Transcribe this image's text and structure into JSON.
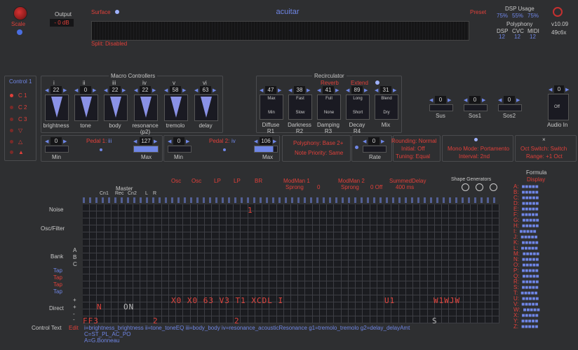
{
  "scale": {
    "label": "Scale"
  },
  "output": {
    "label": "Output",
    "value": "- 0 dB"
  },
  "surface": {
    "label": "Surface",
    "split": "Split: Disabled"
  },
  "title": "acuitar",
  "preset": {
    "label": "Preset"
  },
  "dsp": {
    "label": "DSP Usage",
    "values": [
      "75%",
      "55%",
      "75%"
    ],
    "polyphony_label": "Polyphony",
    "cols": [
      "DSP",
      "CVC",
      "MIDI"
    ],
    "col_values": [
      "12",
      "12",
      "12"
    ]
  },
  "version": {
    "line1": "v10.09",
    "line2": "49c6x"
  },
  "control": {
    "label": "Control 1",
    "items": [
      "C 1",
      "C 2",
      "C 3",
      "▽",
      "△",
      "▲"
    ]
  },
  "macro": {
    "title": "Macro Controllers",
    "items": [
      {
        "roman": "i",
        "value": "22",
        "name": "brightness"
      },
      {
        "roman": "ii",
        "value": "0",
        "name": "tone"
      },
      {
        "roman": "iii",
        "value": "22",
        "name": "body"
      },
      {
        "roman": "iv",
        "value": "22",
        "name": "resonance\n(p2)"
      },
      {
        "roman": "v",
        "value": "58",
        "name": "tremolo"
      },
      {
        "roman": "vi",
        "value": "63",
        "name": "delay"
      }
    ]
  },
  "recirculator": {
    "title": "Recirculator",
    "reverb": "Reverb",
    "extend": "Extend",
    "items": [
      {
        "value": "47",
        "top": "Max",
        "bottom": "Min",
        "name": "Diffuse",
        "sub": "R1"
      },
      {
        "value": "38",
        "top": "Fast",
        "bottom": "Slow",
        "name": "Darkness",
        "sub": "R2"
      },
      {
        "value": "41",
        "top": "Full",
        "bottom": "None",
        "name": "Damping",
        "sub": "R3"
      },
      {
        "value": "89",
        "top": "Long",
        "bottom": "Short",
        "name": "Decay",
        "sub": "R4"
      },
      {
        "value": "31",
        "top": "Blend",
        "bottom": "Dry",
        "name": "Mix",
        "sub": ""
      }
    ]
  },
  "sus": [
    {
      "value": "0",
      "name": "Sus"
    },
    {
      "value": "0",
      "name": "Sos1"
    },
    {
      "value": "0",
      "name": "Sos2"
    }
  ],
  "audio_in": {
    "value": "0",
    "toggle": "Off",
    "name": "Audio In"
  },
  "pedal1": {
    "label": "Pedal 1:",
    "assign": "iii",
    "min_value": "0",
    "max_value": "127",
    "min": "Min",
    "max": "Max"
  },
  "pedal2": {
    "label": "Pedal 2:",
    "assign": "iv",
    "min_value": "0",
    "max_value": "106",
    "min": "Min",
    "max": "Max"
  },
  "polyphony": {
    "line1": "Polyphony: Base 2+",
    "line2": "Note Priority: Same"
  },
  "rate": {
    "value": "0",
    "name": "Rate"
  },
  "rounding": {
    "line1": "Rounding: Normal",
    "line2": "Initial: Off",
    "line3": "Tuning: Equal"
  },
  "mono": {
    "line1": "Mono Mode: Portamento",
    "line2": "Interval: 2nd"
  },
  "oct": {
    "line1": "Oct Switch: Switch",
    "line2": "Range: +1 Oct"
  },
  "master": {
    "label": "Master",
    "subs": [
      "Cn1",
      "Rec",
      "Cn2",
      "L",
      "R"
    ]
  },
  "header_tags": [
    "Osc",
    "Osc",
    "LP",
    "LP",
    "BR",
    "ModMan 1",
    "ModMan 2",
    "SummedDelay"
  ],
  "modman1": {
    "sub": "Sprong",
    "val": "0"
  },
  "modman2": {
    "sub": "Sprong",
    "val": "0 Off"
  },
  "summed": {
    "val": "400 ms"
  },
  "shape_gen": "Shape Generators",
  "formula": {
    "title": "Formula",
    "display": "Display",
    "rows": [
      "A:",
      "B:",
      "C:",
      "D:",
      "E:",
      "F:",
      "G:",
      "H:",
      "I:",
      "J:",
      "K:",
      "L:",
      "M:",
      "N:",
      "O:",
      "P:",
      "Q:",
      "R:",
      "S:",
      "T:",
      "U:",
      "V:",
      "W:",
      "X:",
      "Y:",
      "Z:"
    ]
  },
  "row_labels": {
    "noise": "Noise",
    "osc_filter": "Osc/Filter",
    "bank": "Bank",
    "tap": [
      "Tap",
      "Tap",
      "Tap",
      "Tap"
    ],
    "direct": "Direct",
    "bank_letters": [
      "A",
      "B",
      "C"
    ],
    "direct_signs": [
      "+",
      "+",
      "-",
      "-"
    ]
  },
  "control_text": {
    "label": "Control Text",
    "edit": "Edit",
    "lines": [
      "i=brightness_brightness ii=tone_toneEQ iii=body_body iv=resonance_acousticResonance g1=tremolo_tremolo g2=delay_delayAmt",
      "C=ST_PL_AC_PO",
      "A=G.Bonneau"
    ]
  },
  "grid_text": {
    "on": "ON",
    "seq": "X0 X0 63 V3 T1 XCDL I",
    "u1": "U1",
    "w": "W1WJW",
    "ff3": "FF3",
    "two": "2",
    "two2": "2",
    "n": "N",
    "s": "S",
    "one": "1"
  }
}
